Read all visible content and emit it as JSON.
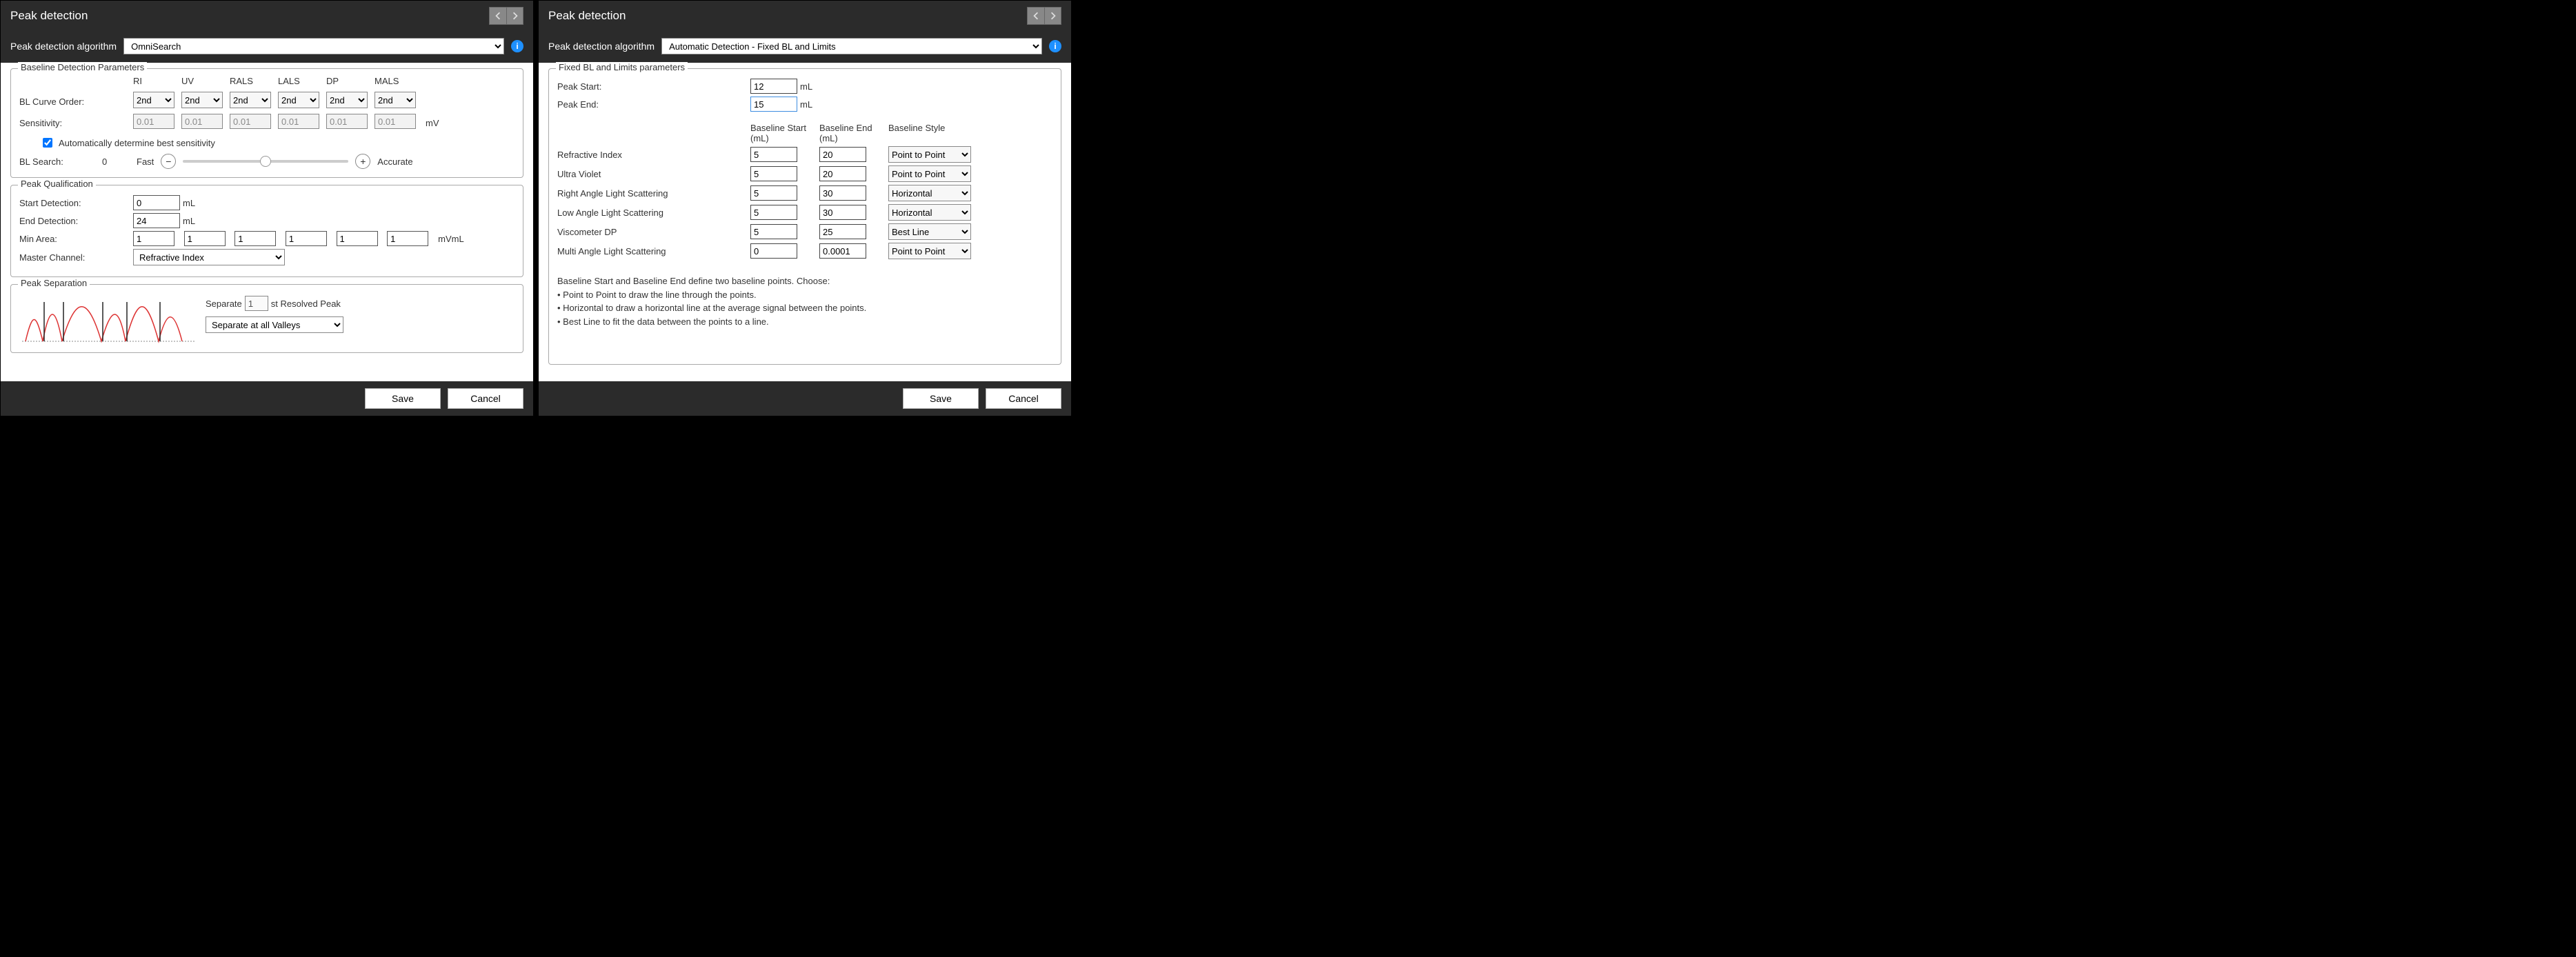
{
  "left": {
    "title": "Peak detection",
    "algo_label": "Peak detection algorithm",
    "algo_value": "OmniSearch",
    "baseline": {
      "legend": "Baseline Detection Parameters",
      "columns": [
        "RI",
        "UV",
        "RALS",
        "LALS",
        "DP",
        "MALS"
      ],
      "bl_curve_order_label": "BL Curve Order:",
      "bl_curve_order_value": "2nd",
      "sensitivity_label": "Sensitivity:",
      "sensitivity_value": "0.01",
      "sensitivity_unit": "mV",
      "auto_sens_label": "Automatically determine best sensitivity",
      "bl_search_label": "BL Search:",
      "bl_search_value": "0",
      "slider_left": "Fast",
      "slider_right": "Accurate"
    },
    "peakq": {
      "legend": "Peak Qualification",
      "start_label": "Start Detection:",
      "start_value": "0",
      "start_unit": "mL",
      "end_label": "End Detection:",
      "end_value": "24",
      "end_unit": "mL",
      "min_area_label": "Min Area:",
      "min_area_values": [
        "1",
        "1",
        "1",
        "1",
        "1",
        "1"
      ],
      "min_area_unit": "mVmL",
      "master_label": "Master Channel:",
      "master_value": "Refractive Index"
    },
    "sep": {
      "legend": "Peak Separation",
      "separate_pre": "Separate",
      "separate_value": "1",
      "separate_post": "st Resolved Peak",
      "mode_value": "Separate at all Valleys"
    },
    "save": "Save",
    "cancel": "Cancel"
  },
  "right": {
    "title": "Peak detection",
    "algo_label": "Peak detection algorithm",
    "algo_value": "Automatic Detection - Fixed BL and Limits",
    "group_legend": "Fixed BL and Limits parameters",
    "peak_start_label": "Peak Start:",
    "peak_start_value": "12",
    "peak_end_label": "Peak End:",
    "peak_end_value": "15",
    "unit_ml": "mL",
    "col1": "Baseline Start (mL)",
    "col2": "Baseline End (mL)",
    "col3": "Baseline Style",
    "rows": [
      {
        "name": "Refractive Index",
        "start": "5",
        "end": "20",
        "style": "Point to Point"
      },
      {
        "name": "Ultra Violet",
        "start": "5",
        "end": "20",
        "style": "Point to Point"
      },
      {
        "name": "Right Angle Light Scattering",
        "start": "5",
        "end": "30",
        "style": "Horizontal"
      },
      {
        "name": "Low Angle Light Scattering",
        "start": "5",
        "end": "30",
        "style": "Horizontal"
      },
      {
        "name": "Viscometer DP",
        "start": "5",
        "end": "25",
        "style": "Best Line"
      },
      {
        "name": "Multi Angle Light Scattering",
        "start": "0",
        "end": "0.0001",
        "style": "Point to Point"
      }
    ],
    "help1": "Baseline Start and Baseline End define two baseline points. Choose:",
    "help2": "• Point to Point to draw the line through the points.",
    "help3": "• Horizontal to draw a horizontal line at the average signal between the points.",
    "help4": "• Best Line to fit the data between the points to a line.",
    "save": "Save",
    "cancel": "Cancel"
  }
}
